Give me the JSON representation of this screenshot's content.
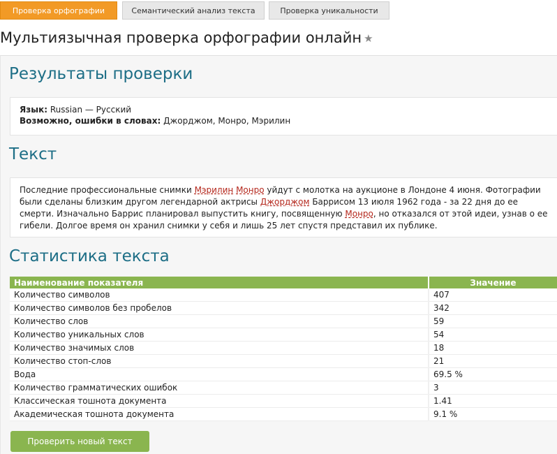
{
  "tabs": [
    {
      "label": "Проверка орфографии",
      "active": true
    },
    {
      "label": "Семантический анализ текста",
      "active": false
    },
    {
      "label": "Проверка уникальности",
      "active": false
    }
  ],
  "page_title": "Мультиязычная проверка орфографии онлайн",
  "results": {
    "heading": "Результаты проверки",
    "language_label": "Язык:",
    "language_value": "Russian — Русский",
    "errors_label": "Возможно, ошибки в словах:",
    "errors_value": "Джорджом, Монро, Мэрилин"
  },
  "text_section": {
    "heading": "Текст",
    "segments": [
      {
        "text": "Последние профессиональные снимки ",
        "type": "plain"
      },
      {
        "text": "Мэрилин",
        "type": "error"
      },
      {
        "text": " ",
        "type": "hl"
      },
      {
        "text": "Монро",
        "type": "error"
      },
      {
        "text": " уйдут с молотка на аукционе в Лондоне 4 июня. Фотографии были сделаны близким другом легендарной актрисы ",
        "type": "plain"
      },
      {
        "text": "Джорджом",
        "type": "error"
      },
      {
        "text": " Баррисом 13 июля 1962 года - за 22 дня до ее смерти. Изначально Баррис планировал выпустить книгу, посвященную ",
        "type": "plain"
      },
      {
        "text": "Монро",
        "type": "error"
      },
      {
        "text": ", но отказался от этой идеи, узнав о ее гибели. Долгое время он хранил снимки у себя и лишь 25 лет спустя представил их публике.",
        "type": "plain"
      }
    ]
  },
  "stats": {
    "heading": "Статистика текста",
    "col_name": "Наименование показателя",
    "col_value": "Значение",
    "rows": [
      {
        "name": "Количество символов",
        "value": "407"
      },
      {
        "name": "Количество символов без пробелов",
        "value": "342"
      },
      {
        "name": "Количество слов",
        "value": "59"
      },
      {
        "name": "Количество уникальных слов",
        "value": "54"
      },
      {
        "name": "Количество значимых слов",
        "value": "18"
      },
      {
        "name": "Количество стоп-слов",
        "value": "21"
      },
      {
        "name": "Вода",
        "value": "69.5 %"
      },
      {
        "name": "Количество грамматических ошибок",
        "value": "3"
      },
      {
        "name": "Классическая тошнота документа",
        "value": "1.41"
      },
      {
        "name": "Академическая тошнота документа",
        "value": "9.1 %"
      }
    ]
  },
  "new_check_button": "Проверить новый текст"
}
